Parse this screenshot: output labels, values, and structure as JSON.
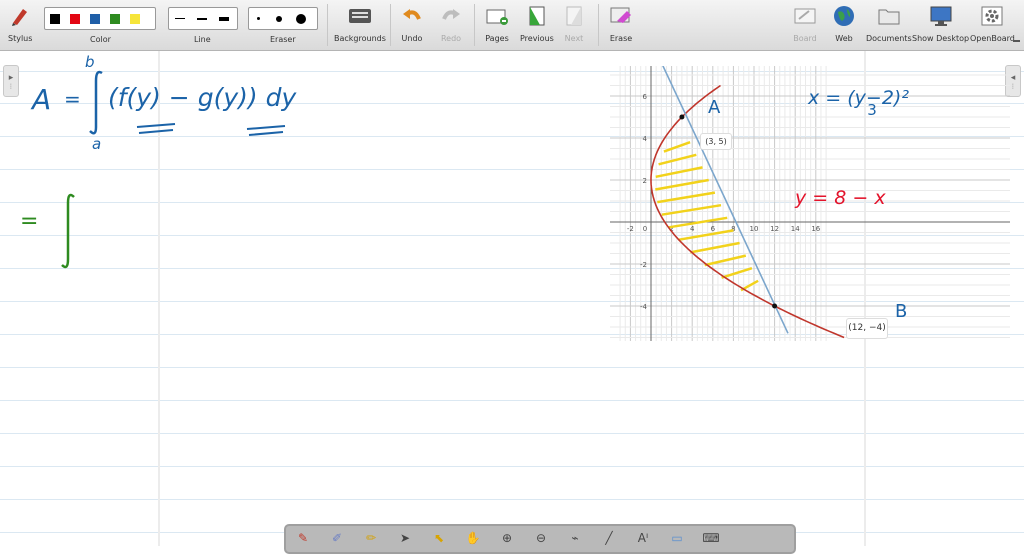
{
  "toolbar": {
    "stylus": "Stylus",
    "color": "Color",
    "line": "Line",
    "eraser": "Eraser",
    "backgrounds": "Backgrounds",
    "undo": "Undo",
    "redo": "Redo",
    "pages": "Pages",
    "previous": "Previous",
    "next": "Next",
    "erase": "Erase",
    "board": "Board",
    "web": "Web",
    "documents": "Documents",
    "show_desktop": "Show Desktop",
    "openboard": "OpenBoard",
    "colors": [
      "#000000",
      "#e30613",
      "#1f5fa8",
      "#2e8b20",
      "#f6e53a"
    ]
  },
  "board": {
    "formula_A": "A",
    "formula_eq": "=",
    "lower_limit": "a",
    "upper_limit": "b",
    "integrand": "(f(y) − g(y)) dy",
    "equals2": "=",
    "curve_label": "x = (y−2)²",
    "curve_label_den": "3",
    "line_label": "y = 8 − x",
    "point_A": "A",
    "point_B": "B",
    "point_A_coord": "(3, 5)",
    "point_B_coord": "(12, −4)",
    "x_ticks": [
      "-2",
      "0",
      "2",
      "4",
      "6",
      "8",
      "10",
      "12",
      "14",
      "16"
    ],
    "y_ticks": [
      "6",
      "4",
      "2",
      "-2",
      "-4"
    ]
  }
}
